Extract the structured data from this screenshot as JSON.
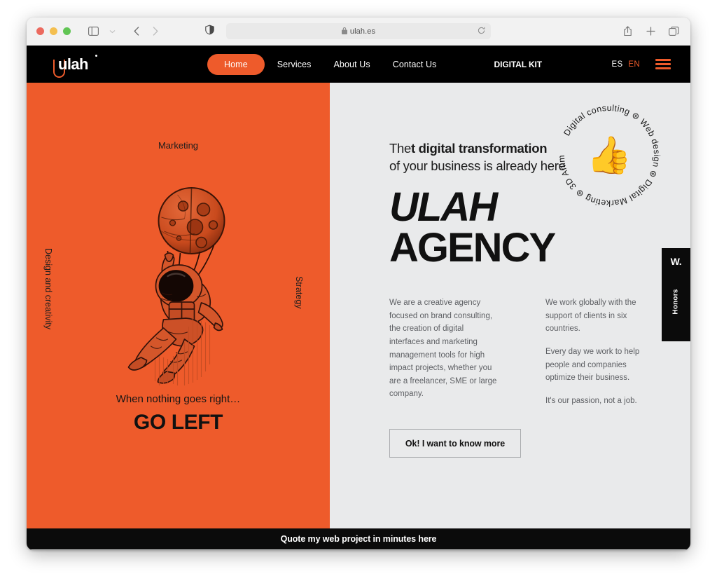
{
  "browser": {
    "url": "ulah.es",
    "lock_icon": "lock-icon",
    "shield_icon": "privacy-shield-icon",
    "reload_icon": "reload-icon",
    "sidebar_icon": "sidebar-toggle-icon",
    "chevron_icon": "chevron-down-icon",
    "back_icon": "back-arrow-icon",
    "forward_icon": "forward-arrow-icon",
    "share_icon": "share-icon",
    "new_tab_icon": "plus-icon",
    "tabs_icon": "tab-overview-icon"
  },
  "nav": {
    "logo": "ulah",
    "links": [
      {
        "label": "Home",
        "active": true
      },
      {
        "label": "Services",
        "active": false
      },
      {
        "label": "About Us",
        "active": false
      },
      {
        "label": "Contact Us",
        "active": false
      }
    ],
    "digital_kit": "DIGITAL KIT",
    "languages": [
      {
        "label": "ES",
        "selected": false
      },
      {
        "label": "EN",
        "selected": true
      }
    ],
    "menu_icon": "hamburger-menu-icon",
    "accent_color": "#ee5b2b"
  },
  "left_panel": {
    "background_color": "#ee5b2b",
    "label_top": "Marketing",
    "label_left": "Design and creativity",
    "label_right": "Strategy",
    "illustration": "astronaut-with-moon-balloon-illustration",
    "tagline": "When nothing goes right…",
    "headline": "GO LEFT"
  },
  "right_panel": {
    "background_color": "#e9eaeb",
    "kicker_light_1": "The",
    "kicker_bold": "t digital transformation",
    "kicker_light_2": "of your business is already here",
    "title_line1": "ULAH",
    "title_line2": "AGENCY",
    "columns": [
      {
        "paragraphs": [
          "We are a creative agency focused on brand consulting, the creation of digital interfaces and marketing management tools for high impact projects, whether you are a freelancer, SME or large company."
        ]
      },
      {
        "paragraphs": [
          "We work globally with the support of clients in six countries.",
          "Every day we work to help people and companies optimize their business.",
          "It's our passion, not a job."
        ]
      }
    ],
    "cta_label": "Ok! I want to know more",
    "badge": {
      "ring_text": "Digital consulting ⊛ Web design ⊛ Digital Marketing ⊛ 3D Animation ⊛",
      "center_icon": "thumbs-up-emoji",
      "center_glyph": "👍"
    }
  },
  "honors_tab": {
    "mark": "W.",
    "label": "Honors",
    "background_color": "#0b0b0b"
  },
  "footer": {
    "text": "Quote my web project in minutes here",
    "background_color": "#0b0b0b"
  }
}
